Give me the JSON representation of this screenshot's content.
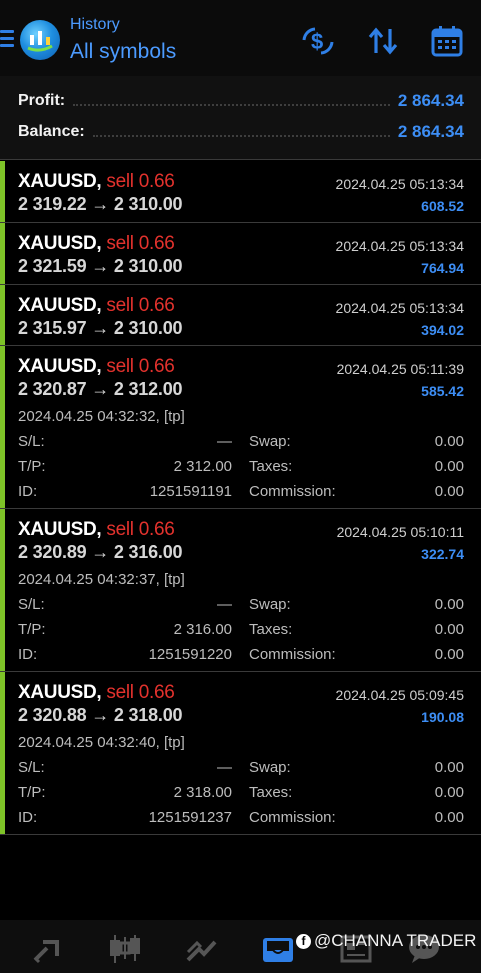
{
  "header": {
    "subtitle": "History",
    "title": "All symbols",
    "accent": "#4c9bff"
  },
  "summary": {
    "profit_label": "Profit:",
    "profit_value": "2 864.34",
    "balance_label": "Balance:",
    "balance_value": "2 864.34"
  },
  "labels": {
    "sl": "S/L:",
    "tp": "T/P:",
    "id": "ID:",
    "swap": "Swap:",
    "taxes": "Taxes:",
    "commission": "Commission:"
  },
  "deals": [
    {
      "symbol": "XAUUSD,",
      "side": "sell 0.66",
      "prices": "2 319.22 → 2 310.00",
      "time": "2024.04.25 05:13:34",
      "profit": "608.52"
    },
    {
      "symbol": "XAUUSD,",
      "side": "sell 0.66",
      "prices": "2 321.59 → 2 310.00",
      "time": "2024.04.25 05:13:34",
      "profit": "764.94"
    },
    {
      "symbol": "XAUUSD,",
      "side": "sell 0.66",
      "prices": "2 315.97 → 2 310.00",
      "time": "2024.04.25 05:13:34",
      "profit": "394.02"
    },
    {
      "symbol": "XAUUSD,",
      "side": "sell 0.66",
      "prices": "2 320.87 → 2 312.00",
      "time": "2024.04.25 05:11:39",
      "profit": "585.42",
      "open_time": "2024.04.25 04:32:32, [tp]",
      "sl": "—",
      "tp": "2 312.00",
      "id": "1251591191",
      "swap": "0.00",
      "taxes": "0.00",
      "commission": "0.00"
    },
    {
      "symbol": "XAUUSD,",
      "side": "sell 0.66",
      "prices": "2 320.89 → 2 316.00",
      "time": "2024.04.25 05:10:11",
      "profit": "322.74",
      "open_time": "2024.04.25 04:32:37, [tp]",
      "sl": "—",
      "tp": "2 316.00",
      "id": "1251591220",
      "swap": "0.00",
      "taxes": "0.00",
      "commission": "0.00"
    },
    {
      "symbol": "XAUUSD,",
      "side": "sell 0.66",
      "prices": "2 320.88 → 2 318.00",
      "time": "2024.04.25 05:09:45",
      "profit": "190.08",
      "open_time": "2024.04.25 04:32:40, [tp]",
      "sl": "—",
      "tp": "2 318.00",
      "id": "1251591237",
      "swap": "0.00",
      "taxes": "0.00",
      "commission": "0.00"
    }
  ],
  "watermark": {
    "icon": "f",
    "text": "@CHANNA TRADER"
  },
  "nav": [
    "quotes-icon",
    "chart-icon",
    "trade-icon",
    "history-icon",
    "news-icon",
    "chat-icon"
  ]
}
